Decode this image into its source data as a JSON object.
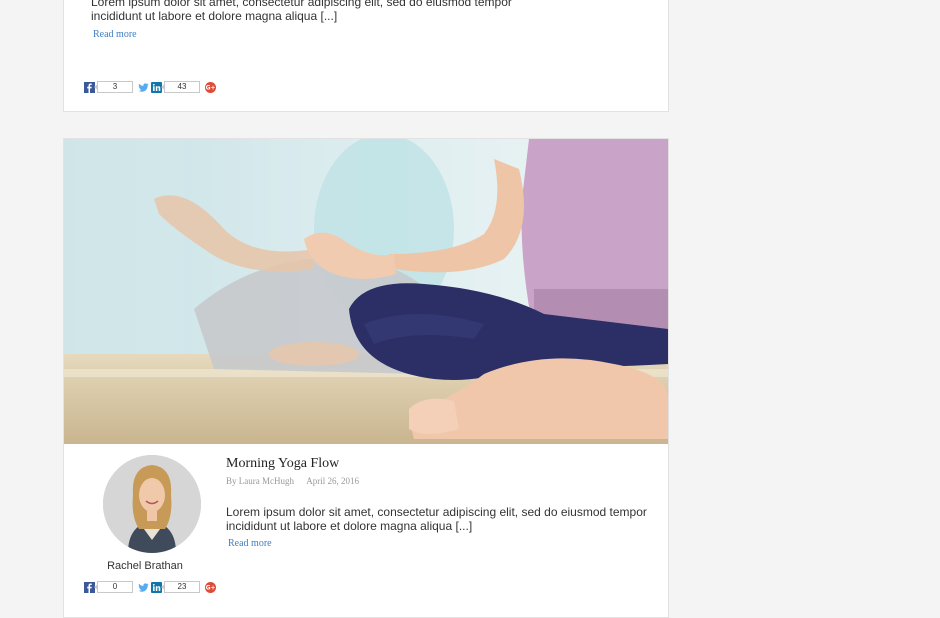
{
  "posts": [
    {
      "excerpt_line1": "Lorem ipsum dolor sit amet, consectetur adipiscing elit, sed do eiusmod tempor",
      "excerpt_line2": "incididunt ut labore et dolore magna aliqua [...]",
      "read_more": "Read more",
      "share": {
        "facebook_count": "3",
        "linkedin_count": "43"
      }
    },
    {
      "title": "Morning Yoga Flow",
      "byline": "By Laura McHugh",
      "date": "April 26, 2016",
      "author_name": "Rachel Brathan",
      "excerpt_line1": "Lorem ipsum dolor sit amet, consectetur adipiscing elit, sed do eiusmod tempor",
      "excerpt_line2": "incididunt ut labore et dolore magna aliqua [...]",
      "read_more": "Read more",
      "share": {
        "facebook_count": "0",
        "linkedin_count": "23"
      }
    }
  ],
  "icons": {
    "facebook": "facebook-icon",
    "twitter": "twitter-icon",
    "linkedin": "linkedin-icon",
    "google_plus": "google-plus-icon"
  },
  "colors": {
    "link": "#3c7fc5",
    "facebook": "#3b5998",
    "twitter": "#55acee",
    "linkedin": "#0e76a8",
    "google_plus": "#dd4b39"
  }
}
